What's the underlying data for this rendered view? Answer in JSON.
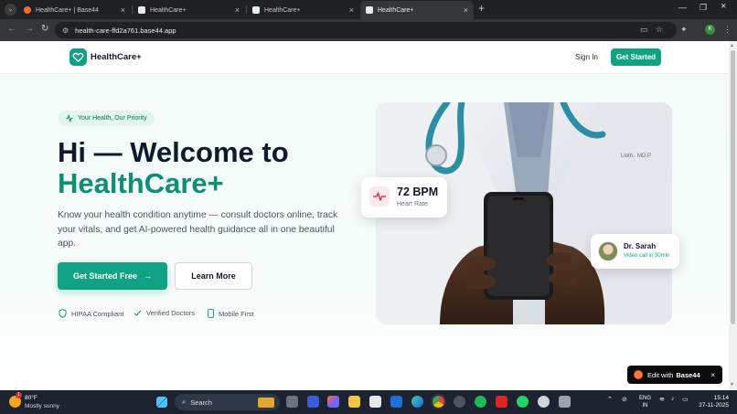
{
  "browser": {
    "tabs": [
      {
        "title": "HealthCare+ | Base44",
        "active": false
      },
      {
        "title": "HealthCare+",
        "active": false
      },
      {
        "title": "HealthCare+",
        "active": false
      },
      {
        "title": "HealthCare+",
        "active": true
      }
    ],
    "url": "health-care-ffd2a761.base44.app"
  },
  "nav": {
    "logo": "HealthCare+",
    "sign_in": "Sign In",
    "get_started": "Get Started"
  },
  "hero": {
    "pill": "Your Health, Our Priority",
    "title_line1": "Hi — Welcome to",
    "title_line2": "HealthCare+",
    "lead": "Know your health condition anytime — consult doctors online, track your vitals, and get AI-powered health guidance all in one beautiful app.",
    "cta_primary": "Get Started Free",
    "cta_secondary": "Learn More",
    "trust": [
      "HIPAA Compliant",
      "Verified Doctors",
      "Mobile First"
    ]
  },
  "cards": {
    "bpm_value": "72 BPM",
    "bpm_label": "Heart Rate",
    "doctor_name": "Dr. Sarah",
    "doctor_sub": "Video call in 30min"
  },
  "badge": {
    "prefix": "Edit with",
    "brand": "Base44"
  },
  "taskbar": {
    "temp": "80°F",
    "weather": "Mostly sunny",
    "weather_badge": "1",
    "search": "Search",
    "lang_line1": "ENG",
    "lang_line2": "IN",
    "time": "15:14",
    "date": "27-11-2025"
  },
  "colors": {
    "brand": "#10a383",
    "heading": "#0f1b2d",
    "accent_heading": "#0e8f74"
  }
}
